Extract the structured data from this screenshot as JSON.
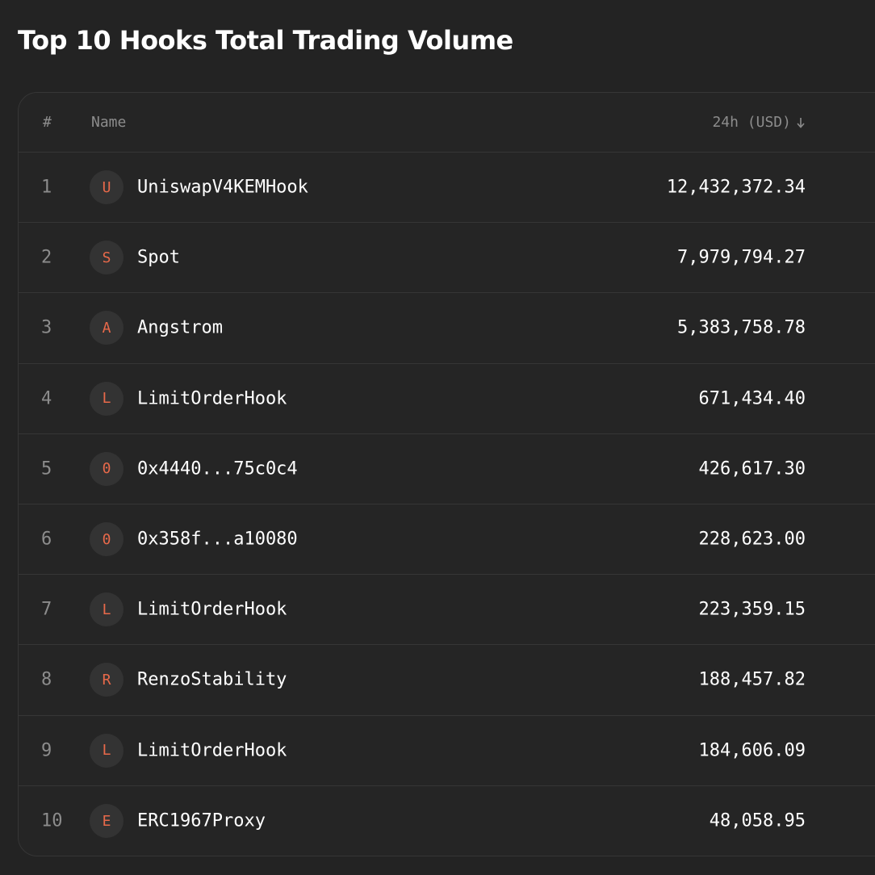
{
  "title": "Top 10 Hooks Total Trading Volume",
  "colors": {
    "background": "#232323",
    "card": "#252525",
    "border": "#363636",
    "muted_text": "#8c8c8c",
    "accent": "#e8694a",
    "avatar_bg": "#333333"
  },
  "table": {
    "headers": {
      "rank": "#",
      "name": "Name",
      "volume": "24h (USD)",
      "sort_icon": "arrow-down-icon"
    },
    "rows": [
      {
        "rank": "1",
        "initial": "U",
        "name": "UniswapV4KEMHook",
        "volume": "12,432,372.34"
      },
      {
        "rank": "2",
        "initial": "S",
        "name": "Spot",
        "volume": "7,979,794.27"
      },
      {
        "rank": "3",
        "initial": "A",
        "name": "Angstrom",
        "volume": "5,383,758.78"
      },
      {
        "rank": "4",
        "initial": "L",
        "name": "LimitOrderHook",
        "volume": "671,434.40"
      },
      {
        "rank": "5",
        "initial": "0",
        "name": "0x4440...75c0c4",
        "volume": "426,617.30"
      },
      {
        "rank": "6",
        "initial": "0",
        "name": "0x358f...a10080",
        "volume": "228,623.00"
      },
      {
        "rank": "7",
        "initial": "L",
        "name": "LimitOrderHook",
        "volume": "223,359.15"
      },
      {
        "rank": "8",
        "initial": "R",
        "name": "RenzoStability",
        "volume": "188,457.82"
      },
      {
        "rank": "9",
        "initial": "L",
        "name": "LimitOrderHook",
        "volume": "184,606.09"
      },
      {
        "rank": "10",
        "initial": "E",
        "name": "ERC1967Proxy",
        "volume": "48,058.95"
      }
    ]
  }
}
